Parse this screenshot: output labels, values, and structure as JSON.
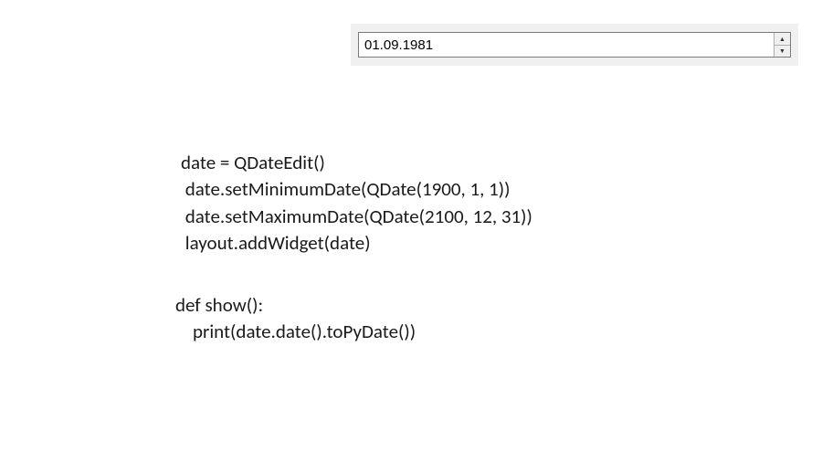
{
  "widget": {
    "date_value": "01.09.1981"
  },
  "code": {
    "line1": "date = QDateEdit()",
    "line2": " date.setMinimumDate(QDate(1900, 1, 1))",
    "line3": " date.setMaximumDate(QDate(2100, 12, 31))",
    "line4": " layout.addWidget(date)",
    "line5": "def show():",
    "line6": "    print(date.date().toPyDate())"
  }
}
